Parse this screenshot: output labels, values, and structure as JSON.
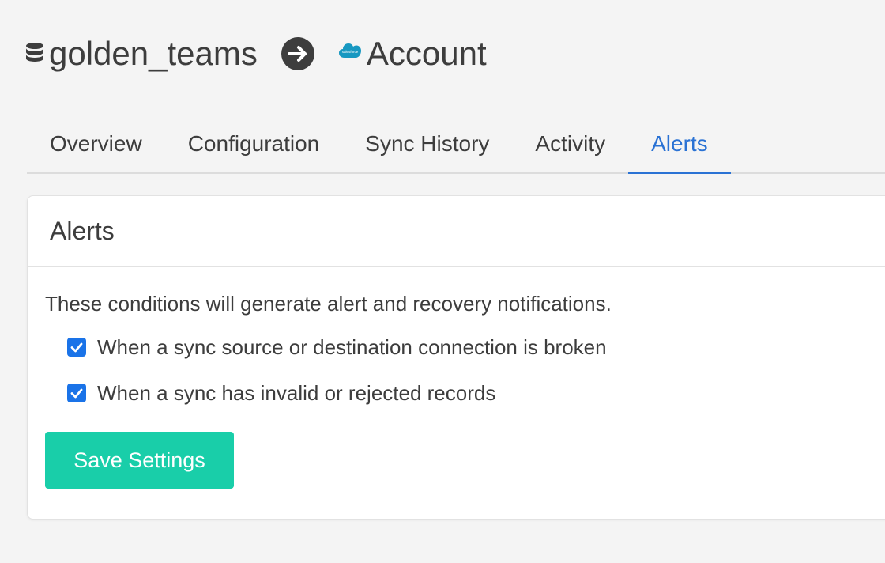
{
  "breadcrumb": {
    "source_name": "golden_teams",
    "source_icon": "database-icon",
    "arrow_icon": "arrow-right-circle-icon",
    "destination_icon": "salesforce-cloud-icon",
    "destination_icon_text": "salesforce",
    "destination_name": "Account"
  },
  "tabs": [
    {
      "label": "Overview",
      "active": false
    },
    {
      "label": "Configuration",
      "active": false
    },
    {
      "label": "Sync History",
      "active": false
    },
    {
      "label": "Activity",
      "active": false
    },
    {
      "label": "Alerts",
      "active": true
    }
  ],
  "alerts_card": {
    "title": "Alerts",
    "description": "These conditions will generate alert and recovery notifications.",
    "conditions": [
      {
        "label": "When a sync source or destination connection is broken",
        "checked": true
      },
      {
        "label": "When a sync has invalid or rejected records",
        "checked": true
      }
    ],
    "save_label": "Save Settings"
  },
  "colors": {
    "accent_blue": "#2a72d4",
    "checkbox_blue": "#1a73e8",
    "save_button": "#19cea9",
    "salesforce_blue": "#1798c1",
    "text": "#3d3d3d",
    "background": "#f4f4f4"
  }
}
